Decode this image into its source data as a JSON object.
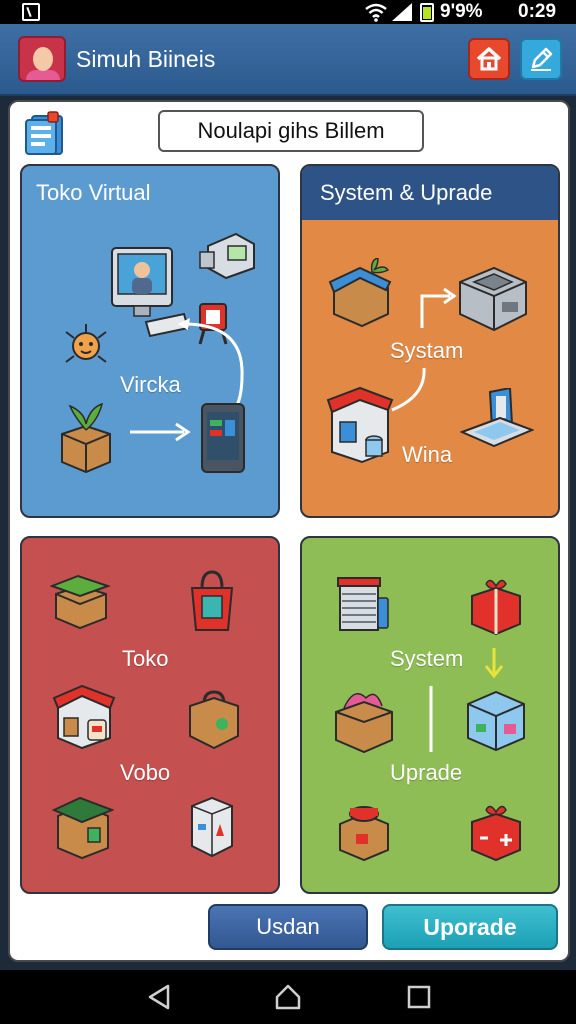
{
  "status_bar": {
    "battery": "9'9%",
    "time": "0:29"
  },
  "app_bar": {
    "title": "Simuh Biineis",
    "home_icon": "home-icon",
    "edit_icon": "pencil-icon"
  },
  "page": {
    "title": "Noulapi gihs Billem"
  },
  "cards": {
    "top_left": {
      "title": "Toko Virtual",
      "label": "Vircka"
    },
    "top_right": {
      "title": "System & Uprade",
      "label_1": "Systam",
      "label_2": "Wina"
    },
    "bottom_left": {
      "label_1": "Toko",
      "label_2": "Vobo"
    },
    "bottom_right": {
      "label_1": "System",
      "label_2": "Uprade"
    }
  },
  "buttons": {
    "left": "Usdan",
    "right": "Uporade"
  },
  "colors": {
    "app_bar": "#2b5a8e",
    "card_blue": "#5b9bd0",
    "card_orange": "#e28a45",
    "card_red": "#c4504f",
    "card_green": "#8fbd55",
    "button_teal": "#1d9fb5"
  }
}
